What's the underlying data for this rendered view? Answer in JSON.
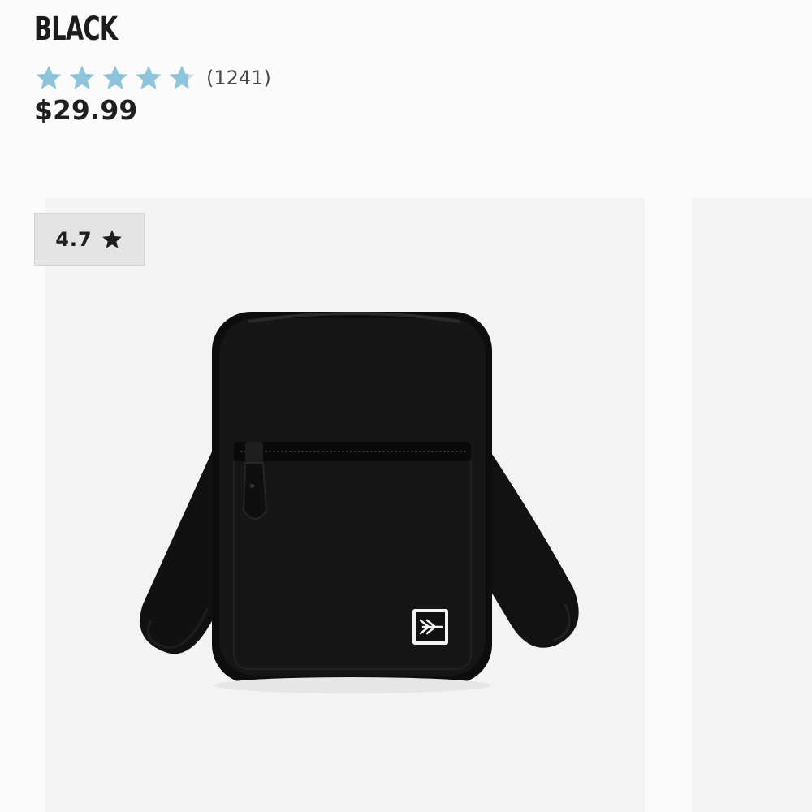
{
  "product": {
    "color_name": "BLACK",
    "review_count": "(1241)",
    "price": "$29.99",
    "star_rating": 4.7,
    "stars_total": 5
  },
  "gallery": {
    "badge_rating": "4.7",
    "badge_icon": "star-icon",
    "image_subject": "black crossbody bag"
  },
  "colors": {
    "star_fill": "#8cc5dc",
    "star_empty": "#d8d8d8",
    "card_bg": "#f3f3f3",
    "badge_bg": "#e4e4e4"
  }
}
